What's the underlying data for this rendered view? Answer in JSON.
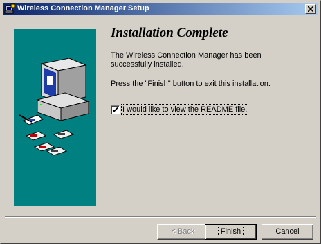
{
  "window": {
    "title": "Wireless Connection Manager Setup",
    "title_icon": "setup-installer-icon",
    "close_icon": "close-icon"
  },
  "main": {
    "heading": "Installation Complete",
    "paragraph1": "The Wireless Connection Manager has been successfully installed.",
    "paragraph2": "Press the \"Finish\" button to exit this installation.",
    "readme_checkbox": {
      "label": "I would like to view the README file.",
      "checked": true
    }
  },
  "illustration": {
    "icon": "computer-with-disks-icon",
    "background": "#008080"
  },
  "buttons": {
    "back": "< Back",
    "finish": "Finish",
    "cancel": "Cancel"
  },
  "colors": {
    "titlebar_start": "#0a246a",
    "titlebar_end": "#a6caf0",
    "dialog_face": "#d4d0c8"
  }
}
